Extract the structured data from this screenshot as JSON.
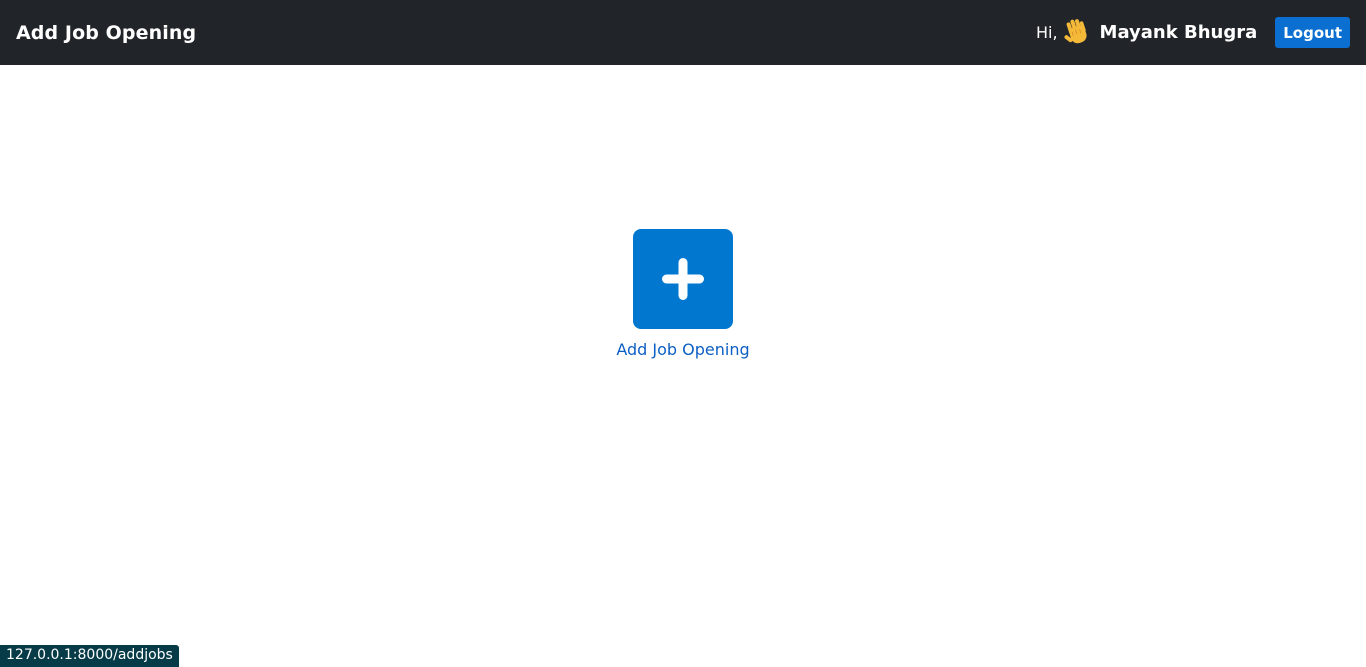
{
  "navbar": {
    "brand": "Add Job Opening",
    "greeting": "Hi,",
    "wave_icon": "waving-hand-emoji",
    "username": "Mayank Bhugra",
    "logout_label": "Logout"
  },
  "main": {
    "tile_icon": "plus-icon",
    "tile_label": "Add Job Opening"
  },
  "status_bar": {
    "url": "127.0.0.1:8000/addjobs"
  },
  "colors": {
    "navbar_bg": "#212529",
    "accent": "#0277cf",
    "link_text": "#0d5fc4"
  }
}
